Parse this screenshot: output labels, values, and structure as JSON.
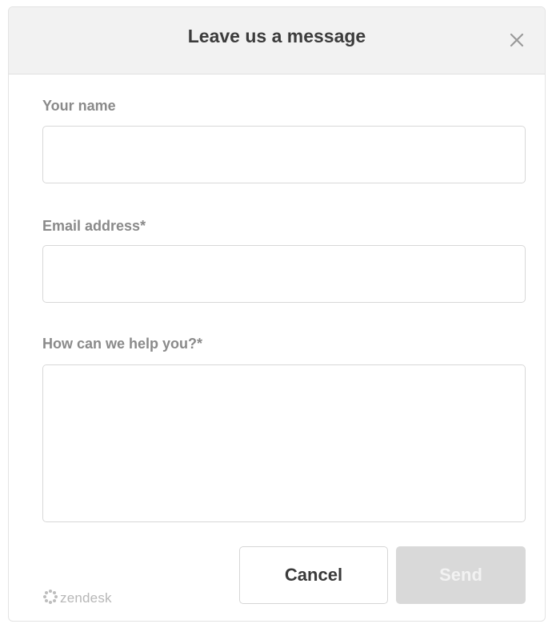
{
  "header": {
    "title": "Leave us a message",
    "close_icon": "close-icon"
  },
  "form": {
    "name_label": "Your name",
    "name_value": "",
    "email_label": "Email address*",
    "email_value": "",
    "message_label": "How can we help you?*",
    "message_value": ""
  },
  "actions": {
    "cancel_label": "Cancel",
    "send_label": "Send",
    "send_enabled": false
  },
  "footer": {
    "brand_name": "zendesk",
    "brand_icon": "zendesk-logo-icon"
  },
  "colors": {
    "header_bg": "#f2f2f2",
    "label_text": "#8a8a8a",
    "send_disabled_bg": "#d9d9d9",
    "border": "#d8d8d8"
  }
}
